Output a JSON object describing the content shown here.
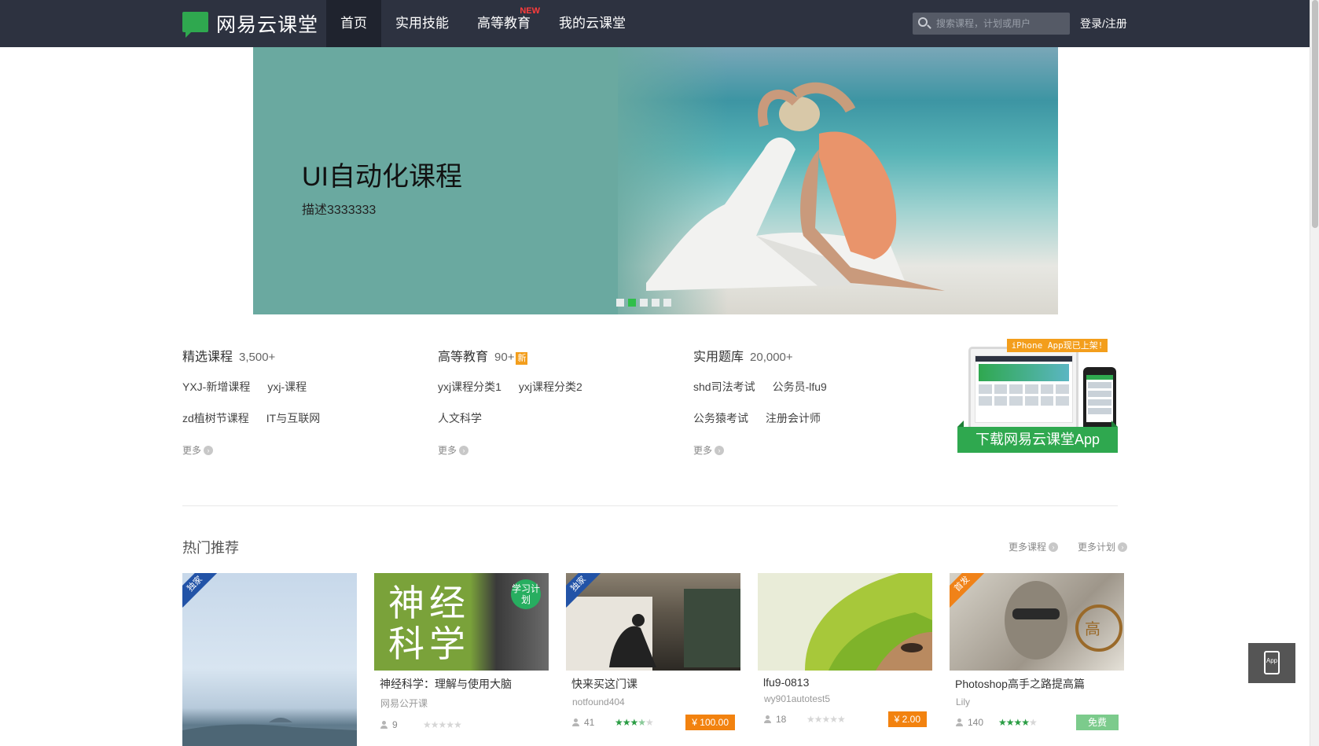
{
  "brand": {
    "name": "网易云课堂",
    "accent": "#2fa84f"
  },
  "nav": {
    "items": [
      {
        "label": "首页",
        "active": true
      },
      {
        "label": "实用技能"
      },
      {
        "label": "高等教育",
        "badge": "NEW"
      },
      {
        "label": "我的云课堂"
      }
    ]
  },
  "search": {
    "placeholder": "搜索课程，计划或用户"
  },
  "auth": {
    "label": "登录/注册"
  },
  "banner": {
    "title": "UI自动化课程",
    "description": "描述3333333",
    "slide_count": 5,
    "active_slide": 2
  },
  "categories": [
    {
      "title": "精选课程",
      "count": "3,500+",
      "rows": [
        [
          "YXJ-新增课程",
          "yxj-课程"
        ],
        [
          "zd植树节课程",
          "IT与互联网"
        ]
      ],
      "more": "更多"
    },
    {
      "title": "高等教育",
      "count": "90+",
      "tag": "新",
      "rows": [
        [
          "yxj课程分类1",
          "yxj课程分类2"
        ],
        [
          "人文科学"
        ]
      ],
      "more": "更多"
    },
    {
      "title": "实用题库",
      "count": "20,000+",
      "rows": [
        [
          "shd司法考试",
          "公务员-lfu9"
        ],
        [
          "公务猿考试",
          "注册会计师"
        ]
      ],
      "more": "更多"
    }
  ],
  "app_promo": {
    "tag": "iPhone App现已上架!",
    "button": "下载网易云课堂App"
  },
  "hot": {
    "title": "热门推荐",
    "more_courses": "更多课程",
    "more_plans": "更多计划",
    "cards": [
      {
        "ribbon": "独家",
        "ribbon_color": "blue",
        "title": "",
        "author": "",
        "users": "",
        "rating": 0,
        "price": ""
      },
      {
        "image_text": "神经科学",
        "plan_badge": "学习计划",
        "title": "神经科学：理解与使用大脑",
        "author": "网易公开课",
        "users": "9",
        "rating": 0,
        "price": ""
      },
      {
        "ribbon": "独家",
        "ribbon_color": "blue",
        "title": "快来买这门课",
        "author": "notfound404",
        "users": "41",
        "rating": 3.5,
        "price": "¥ 100.00"
      },
      {
        "title": "lfu9-0813",
        "author": "wy901autotest5",
        "users": "18",
        "rating": 0,
        "price": "¥ 2.00"
      },
      {
        "ribbon": "首发",
        "ribbon_color": "orange",
        "title": "Photoshop高手之路提高篇",
        "author": "Lily",
        "users": "140",
        "rating": 4,
        "price": "免费",
        "free": true
      }
    ]
  },
  "float_app": {
    "label": "App"
  }
}
